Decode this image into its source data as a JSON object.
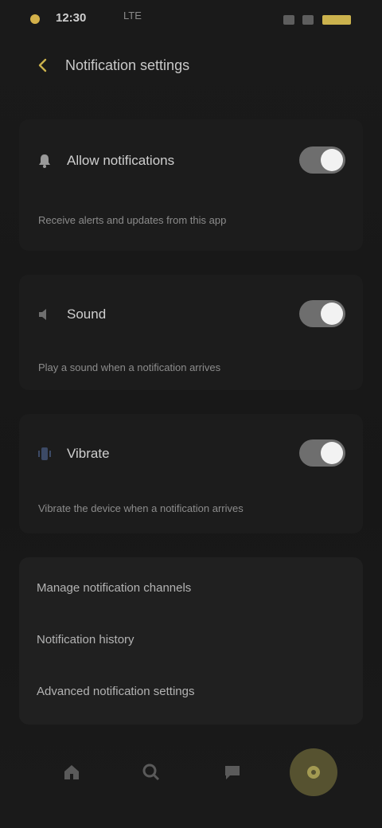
{
  "status_bar": {
    "time": "12:30",
    "carrier": "LTE",
    "battery_color": "#cbb24d"
  },
  "header": {
    "title": "Notification settings",
    "back_icon": "back-arrow-icon"
  },
  "settings": [
    {
      "icon": "bell-icon",
      "title": "Allow notifications",
      "description": "Receive alerts and updates from this app",
      "enabled": true
    },
    {
      "icon": "sound-icon",
      "title": "Sound",
      "description": "Play a sound when a notification arrives",
      "enabled": true
    },
    {
      "icon": "vibration-icon",
      "title": "Vibrate",
      "description": "Vibrate the device when a notification arrives",
      "enabled": true
    }
  ],
  "links": [
    "Manage notification channels",
    "Notification history",
    "Advanced notification settings"
  ],
  "bottom_nav": {
    "items": [
      {
        "icon": "home-icon"
      },
      {
        "icon": "search-icon"
      },
      {
        "icon": "chat-icon"
      },
      {
        "icon": "settings-icon",
        "active": true
      }
    ],
    "accent": "#565230"
  }
}
